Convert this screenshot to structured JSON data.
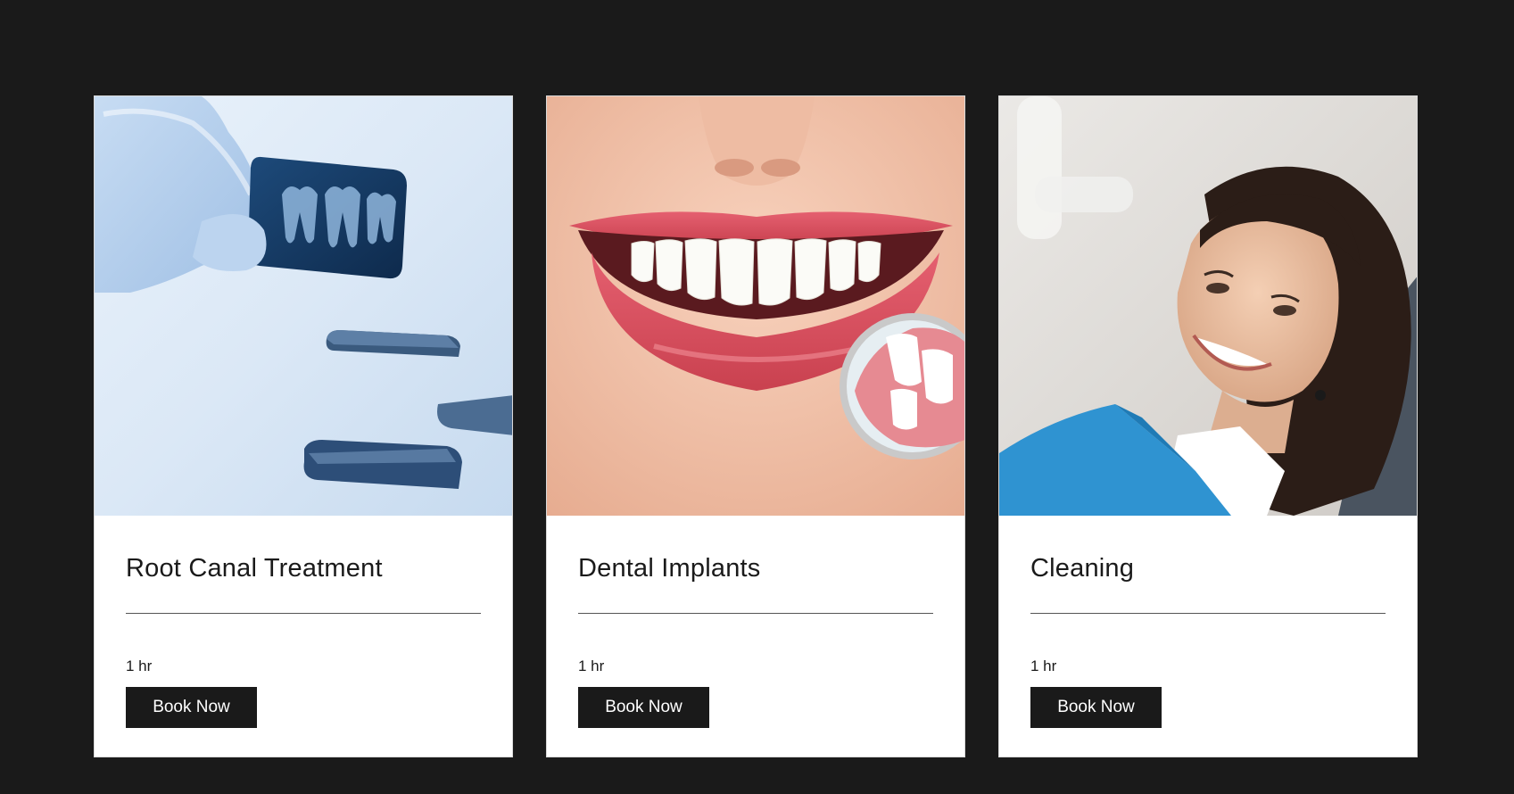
{
  "colors": {
    "background": "#1a1a1a",
    "card": "#ffffff",
    "button": "#1a1a1a",
    "button_text": "#ffffff"
  },
  "services": [
    {
      "title": "Root Canal Treatment",
      "duration": "1 hr",
      "button_label": "Book Now",
      "image": "dental-xray-photo"
    },
    {
      "title": "Dental Implants",
      "duration": "1 hr",
      "button_label": "Book Now",
      "image": "smile-with-dental-mirror-photo"
    },
    {
      "title": "Cleaning",
      "duration": "1 hr",
      "button_label": "Book Now",
      "image": "smiling-patient-photo"
    }
  ]
}
